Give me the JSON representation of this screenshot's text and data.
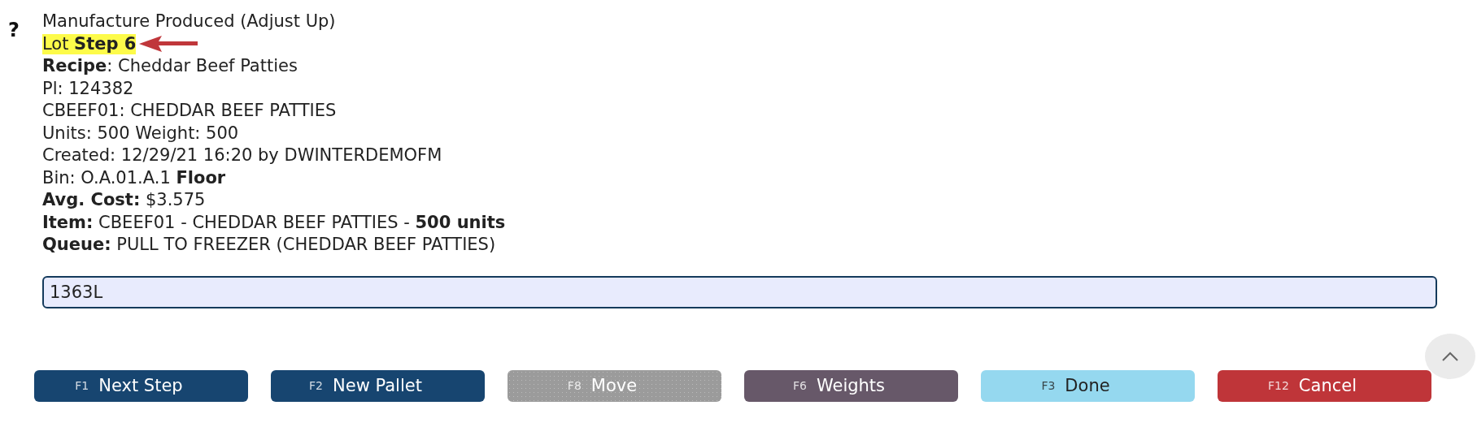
{
  "help_icon": "?",
  "lines": [
    {
      "text": "Manufacture Produced (Adjust Up)",
      "highlighted": false
    },
    {
      "text": "Lot **Step 6**",
      "highlighted": true
    },
    {
      "text": "**Recipe**: Cheddar Beef Patties",
      "highlighted": false
    },
    {
      "text": "Pl: 124382",
      "highlighted": false
    },
    {
      "text": "CBEEF01: CHEDDAR BEEF PATTIES",
      "highlighted": false
    },
    {
      "text": "Units: 500 Weight: 500",
      "highlighted": false
    },
    {
      "text": "Created: 12/29/21 16:20 by DWINTERDEMOFM",
      "highlighted": false
    },
    {
      "text": "Bin: O.A.01.A.1 **Floor**",
      "highlighted": false
    },
    {
      "text": "**Avg. Cost:** $3.575",
      "highlighted": false
    },
    {
      "text": "**Item:** CBEEF01 - CHEDDAR BEEF PATTIES - **500 units**",
      "highlighted": false
    },
    {
      "text": "**Queue:** PULL TO FREEZER (CHEDDAR BEEF PATTIES)",
      "highlighted": false
    }
  ],
  "input": {
    "value": "1363L"
  },
  "buttons": [
    {
      "key": "F1",
      "label": "Next Step",
      "color": "#174570",
      "disabled": false
    },
    {
      "key": "F2",
      "label": "New Pallet",
      "color": "#174570",
      "disabled": false
    },
    {
      "key": "F8",
      "label": "Move",
      "color": "#9b9b9b",
      "disabled": true
    },
    {
      "key": "F6",
      "label": "Weights",
      "color": "#675869",
      "disabled": false
    },
    {
      "key": "F3",
      "label": "Done",
      "color": "#95d8ef",
      "disabled": false
    },
    {
      "key": "F12",
      "label": "Cancel",
      "color": "#bf3539",
      "disabled": false
    }
  ]
}
